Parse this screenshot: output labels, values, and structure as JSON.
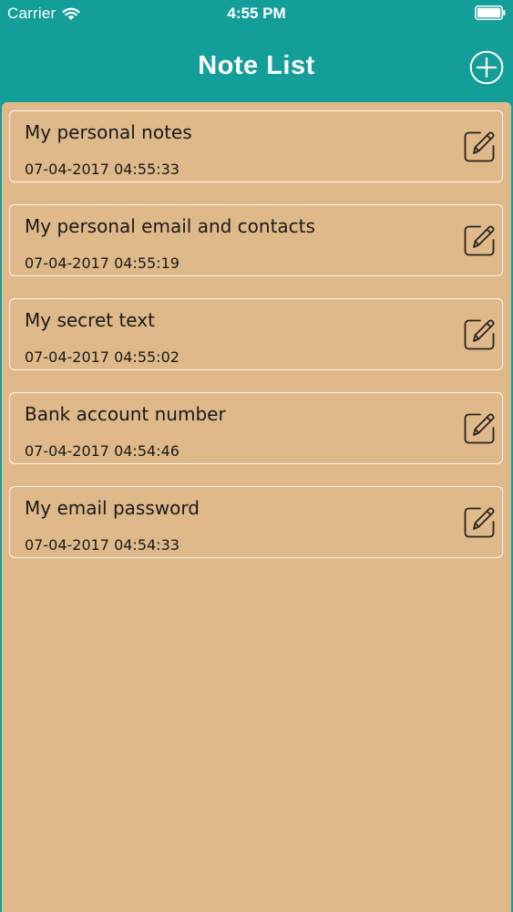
{
  "status_bar": {
    "carrier": "Carrier",
    "time": "4:55 PM"
  },
  "nav": {
    "title": "Note List"
  },
  "colors": {
    "header": "#149E9A",
    "content_background": "#DFB98A",
    "card_border": "#FFF6EA"
  },
  "icons": {
    "add": "plus-circle-icon",
    "edit": "edit-pencil-icon",
    "wifi": "wifi-icon",
    "battery": "battery-icon"
  },
  "notes": [
    {
      "title": "My personal notes",
      "date": "07-04-2017 04:55:33"
    },
    {
      "title": "My personal email and contacts",
      "date": "07-04-2017 04:55:19"
    },
    {
      "title": "My secret text",
      "date": "07-04-2017 04:55:02"
    },
    {
      "title": "Bank account number",
      "date": "07-04-2017 04:54:46"
    },
    {
      "title": "My email password",
      "date": "07-04-2017 04:54:33"
    }
  ]
}
